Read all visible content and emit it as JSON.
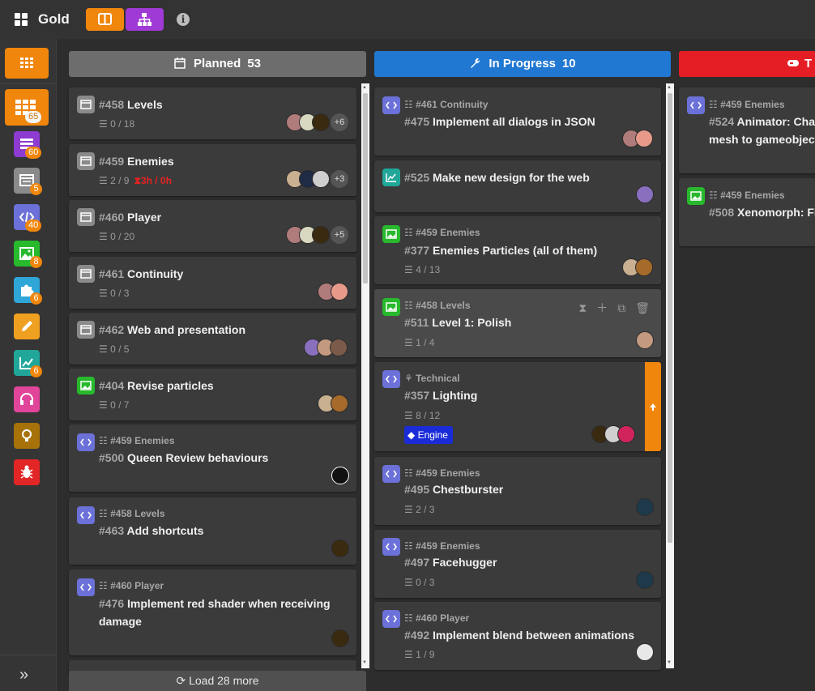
{
  "app": {
    "title": "Gold"
  },
  "colors": {
    "orange": "#f0860c",
    "purple": "#a03ad6",
    "blue": "#2178d2",
    "red": "#e51e25",
    "gray_header": "#6d6d6d"
  },
  "sidebar": {
    "items": [
      {
        "icon": "grid-icon",
        "badge": "65",
        "color": "#f0860c"
      },
      {
        "icon": "list-icon",
        "badge": "60",
        "color": "#8d3bd1"
      },
      {
        "icon": "window-icon",
        "badge": "5",
        "color": "#8a8a8a"
      },
      {
        "icon": "code-icon",
        "badge": "40",
        "color": "#6b71d8"
      },
      {
        "icon": "image-icon",
        "badge": "8",
        "color": "#28b92d"
      },
      {
        "icon": "puzzle-icon",
        "badge": "6",
        "color": "#2fa6d8"
      },
      {
        "icon": "pencil-icon",
        "badge": "",
        "color": "#f0a020"
      },
      {
        "icon": "chart-icon",
        "badge": "6",
        "color": "#20a79a"
      },
      {
        "icon": "headphones-icon",
        "badge": "",
        "color": "#e0459a"
      },
      {
        "icon": "bulb-icon",
        "badge": "",
        "color": "#a7720a"
      },
      {
        "icon": "bug-icon",
        "badge": "",
        "color": "#e22525"
      }
    ],
    "expand_glyph": "»"
  },
  "columns": [
    {
      "name": "Planned",
      "count": "53",
      "icon": "calendar-icon"
    },
    {
      "name": "In Progress",
      "count": "10",
      "icon": "wrench-icon"
    },
    {
      "name": "T",
      "count": "",
      "icon": "gamepad-icon"
    }
  ],
  "planned": [
    {
      "num": "#458",
      "title": "Levels",
      "sub": "0 / 18",
      "more": "+6"
    },
    {
      "num": "#459",
      "title": "Enemies",
      "sub": "2 / 9",
      "overdue": "3h / 0h",
      "more": "+3"
    },
    {
      "num": "#460",
      "title": "Player",
      "sub": "0 / 20",
      "more": "+5"
    },
    {
      "num": "#461",
      "title": "Continuity",
      "sub": "0 / 3"
    },
    {
      "num": "#462",
      "title": "Web and presentation",
      "sub": "0 / 5"
    },
    {
      "num": "#404",
      "title": "Revise particles",
      "sub": "0 / 7"
    },
    {
      "parent": "#459 Enemies",
      "num": "#500",
      "title": "Queen Review behaviours"
    },
    {
      "parent": "#458 Levels",
      "num": "#463",
      "title": "Add shortcuts"
    },
    {
      "parent": "#460 Player",
      "num": "#476",
      "title_line1": "Implement red shader when receiving",
      "title_line2": "damage"
    }
  ],
  "in_progress": [
    {
      "parent": "#461 Continuity",
      "num": "#475",
      "title": "Implement all dialogs in JSON"
    },
    {
      "num": "#525",
      "title": "Make new design for the web"
    },
    {
      "parent": "#459 Enemies",
      "num": "#377",
      "title": "Enemies Particles (all of them)",
      "sub": "4 / 13"
    },
    {
      "parent": "#458 Levels",
      "num": "#511",
      "title": "Level 1: Polish",
      "sub": "1 / 4"
    },
    {
      "parent": "Technical",
      "num": "#357",
      "title": "Lighting",
      "sub": "8 / 12",
      "tag": "Engine"
    },
    {
      "parent": "#459 Enemies",
      "num": "#495",
      "title": "Chestburster",
      "sub": "2 / 3"
    },
    {
      "parent": "#459 Enemies",
      "num": "#497",
      "title": "Facehugger",
      "sub": "0 / 3"
    },
    {
      "parent": "#460 Player",
      "num": "#492",
      "title": "Implement blend between animations",
      "sub": "1 / 9"
    }
  ],
  "third": [
    {
      "parent": "#459 Enemies",
      "num": "#524",
      "title_line1": "Animator: Char",
      "title_line2": "mesh to gameobject"
    },
    {
      "parent": "#459 Enemies",
      "num": "#508",
      "title": "Xenomorph: Fi"
    }
  ],
  "load_more": "Load 28 more"
}
